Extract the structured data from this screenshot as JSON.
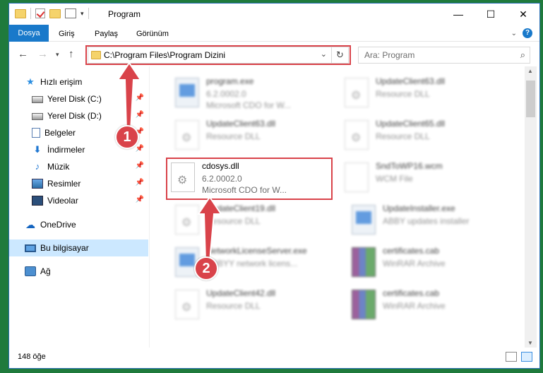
{
  "window": {
    "title": "Program",
    "buttons": {
      "minimize": "—",
      "maximize": "☐",
      "close": "✕"
    }
  },
  "ribbon": {
    "tabs": [
      "Dosya",
      "Giriş",
      "Paylaş",
      "Görünüm"
    ]
  },
  "address": {
    "path": "C:\\Program Files\\Program Dizini",
    "search_placeholder": "Ara: Program"
  },
  "sidebar": {
    "items": [
      {
        "label": "Hızlı erişim",
        "icon": "star-icon"
      },
      {
        "label": "Yerel Disk (C:)",
        "icon": "disk-icon"
      },
      {
        "label": "Yerel Disk (D:)",
        "icon": "disk-icon"
      },
      {
        "label": "Belgeler",
        "icon": "documents-icon"
      },
      {
        "label": "İndirmeler",
        "icon": "download-icon"
      },
      {
        "label": "Müzik",
        "icon": "music-icon"
      },
      {
        "label": "Resimler",
        "icon": "pictures-icon"
      },
      {
        "label": "Videolar",
        "icon": "videos-icon"
      },
      {
        "label": "OneDrive",
        "icon": "onedrive-icon"
      },
      {
        "label": "Bu bilgisayar",
        "icon": "computer-icon"
      },
      {
        "label": "Ağ",
        "icon": "network-icon"
      }
    ]
  },
  "files": [
    {
      "name": "program.exe",
      "line2": "6.2.0002.0",
      "line3": "Microsoft CDO for W...",
      "type": "exe"
    },
    {
      "name": "UpdateClient63.dll",
      "line2": "Resource DLL",
      "line3": "",
      "type": "dll"
    },
    {
      "name": "UpdateClient63.dll",
      "line2": "Resource DLL",
      "line3": "",
      "type": "dll"
    },
    {
      "name": "UpdateClient65.dll",
      "line2": "Resource DLL",
      "line3": "",
      "type": "dll"
    },
    {
      "name": "cdosys.dll",
      "line2": "6.2.0002.0",
      "line3": "Microsoft CDO for W...",
      "type": "dll"
    },
    {
      "name": "SndToWP16.wcm",
      "line2": "WCM File",
      "line3": "",
      "type": "doc"
    },
    {
      "name": "UpdateClient19.dll",
      "line2": "Resource DLL",
      "line3": "",
      "type": "dll"
    },
    {
      "name": "UpdateInstaller.exe",
      "line2": "ABBY updates installer",
      "line3": "",
      "type": "exe"
    },
    {
      "name": "NetworkLicenseServer.exe",
      "line2": "ABBYY network licens...",
      "line3": "",
      "type": "exe"
    },
    {
      "name": "certificates.cab",
      "line2": "WinRAR Archive",
      "line3": "",
      "type": "cab"
    },
    {
      "name": "UpdateClient42.dll",
      "line2": "Resource DLL",
      "line3": "",
      "type": "dll"
    },
    {
      "name": "certificates.cab",
      "line2": "WinRAR Archive",
      "line3": "",
      "type": "cab"
    }
  ],
  "status": {
    "count": "148 öğe"
  },
  "annotations": {
    "step1": "1",
    "step2": "2",
    "accent": "#d9434a"
  }
}
